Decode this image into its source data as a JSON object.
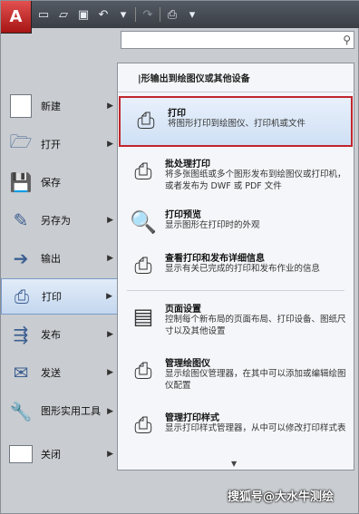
{
  "app": {
    "logo": "A"
  },
  "toolbar": {
    "icons": [
      "new-icon",
      "open-icon",
      "save-icon",
      "undo-icon",
      "redo-icon",
      "plot-icon"
    ],
    "undo_arrow": "▾",
    "plot_arrow": "▾"
  },
  "left_menu": [
    {
      "label": "新建",
      "icon": "new-doc-icon",
      "has_arrow": true
    },
    {
      "label": "打开",
      "icon": "open-folder-icon",
      "has_arrow": true
    },
    {
      "label": "保存",
      "icon": "save-disk-icon",
      "has_arrow": false
    },
    {
      "label": "另存为",
      "icon": "save-as-icon",
      "has_arrow": true
    },
    {
      "label": "输出",
      "icon": "export-icon",
      "has_arrow": true
    },
    {
      "label": "打印",
      "icon": "printer-icon",
      "has_arrow": true,
      "active": true
    },
    {
      "label": "发布",
      "icon": "publish-icon",
      "has_arrow": true
    },
    {
      "label": "发送",
      "icon": "send-icon",
      "has_arrow": true
    },
    {
      "label": "图形实用工具",
      "icon": "utilities-icon",
      "has_arrow": true
    },
    {
      "label": "关闭",
      "icon": "close-folder-icon",
      "has_arrow": true
    }
  ],
  "submenu": {
    "header": "|形输出到绘图仪或其他设备",
    "items": [
      {
        "title": "打印",
        "desc": "将图形打印到绘图仪、打印机或文件",
        "icon": "plot-printer-icon",
        "highlighted": true
      },
      {
        "title": "批处理打印",
        "desc": "将多张图纸或多个图形发布到绘图仪或打印机，或者发布为 DWF 或 PDF 文件",
        "icon": "batch-plot-icon"
      },
      {
        "title": "打印预览",
        "desc": "显示图形在打印时的外观",
        "icon": "plot-preview-icon"
      },
      {
        "title": "查看打印和发布详细信息",
        "desc": "显示有关已完成的打印和发布作业的信息",
        "icon": "plot-details-icon"
      },
      {
        "title": "页面设置",
        "desc": "控制每个新布局的页面布局、打印设备、图纸尺寸以及其他设置",
        "icon": "page-setup-icon"
      },
      {
        "title": "管理绘图仪",
        "desc": "显示绘图仪管理器，在其中可以添加或编辑绘图仪配置",
        "icon": "plotter-manager-icon"
      },
      {
        "title": "管理打印样式",
        "desc": "显示打印样式管理器，从中可以修改打印样式表",
        "icon": "plot-styles-icon"
      }
    ]
  },
  "watermark": "搜狐号@大水牛测绘"
}
